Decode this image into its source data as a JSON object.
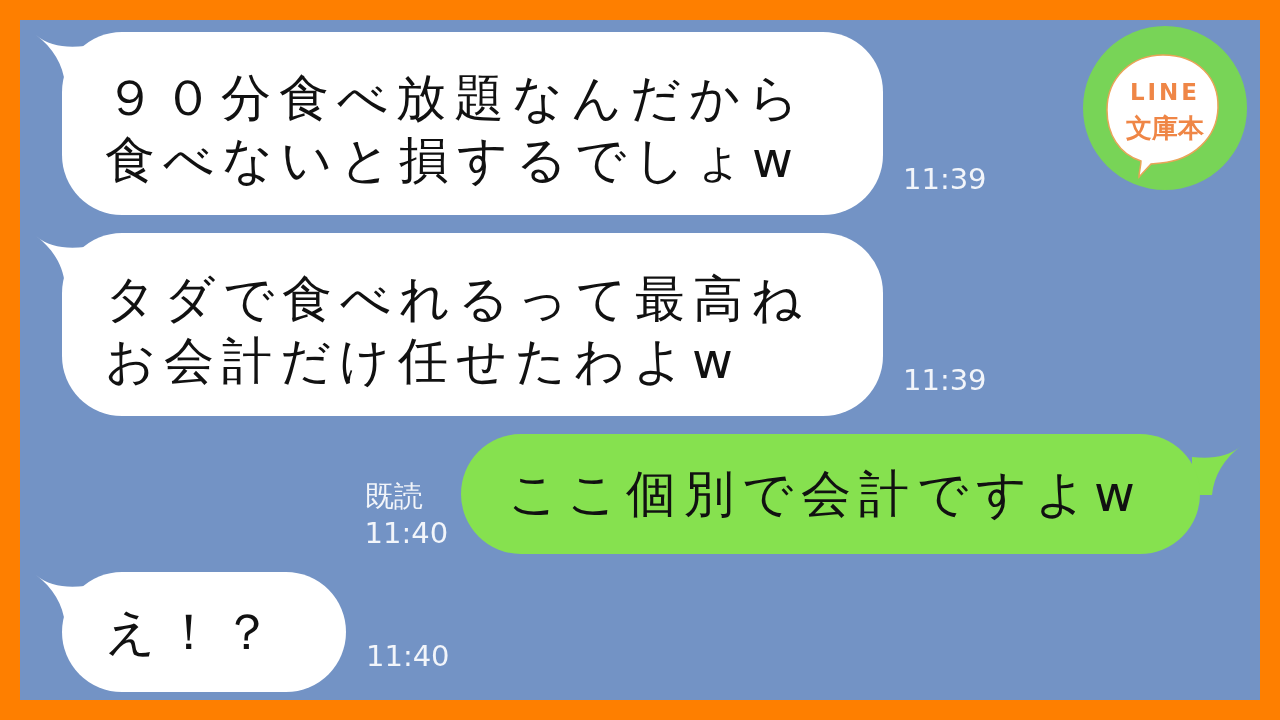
{
  "logo": {
    "line1": "LINE",
    "line2": "文庫本"
  },
  "messages": [
    {
      "kind": "received",
      "text": "９０分食べ放題なんだから食べないと損するでしょw",
      "time": "11:39"
    },
    {
      "kind": "received",
      "text": "タダで食べれるって最高ねお会計だけ任せたわよw",
      "time": "11:39"
    },
    {
      "kind": "sent",
      "text": "ここ個別で会計ですよw",
      "read": "既読",
      "time": "11:40"
    },
    {
      "kind": "received",
      "text": "え！？",
      "time": "11:40"
    }
  ]
}
